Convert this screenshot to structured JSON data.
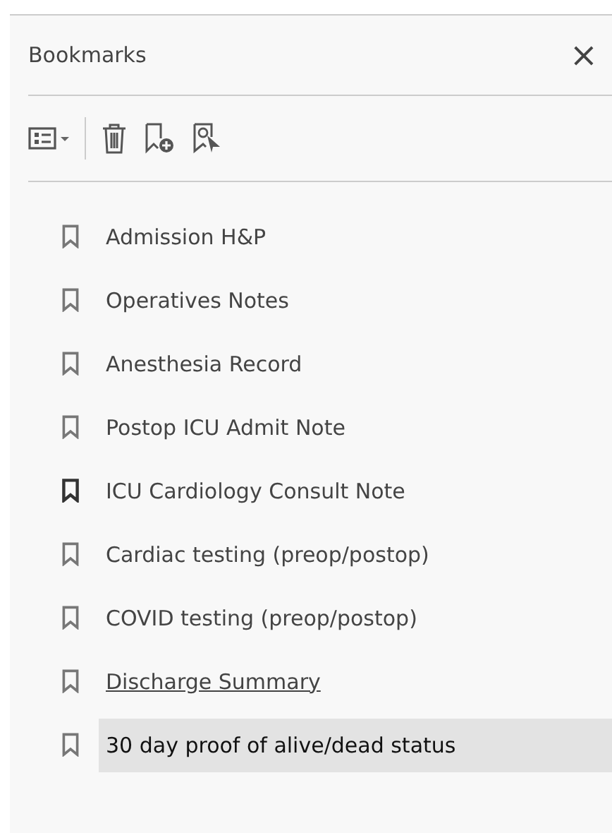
{
  "panel": {
    "title": "Bookmarks",
    "close": "×"
  },
  "bookmarks": [
    {
      "label": "Admission H&P",
      "selected": false,
      "hovered": false,
      "emphasized": false
    },
    {
      "label": "Operatives Notes",
      "selected": false,
      "hovered": false,
      "emphasized": false
    },
    {
      "label": "Anesthesia Record",
      "selected": false,
      "hovered": false,
      "emphasized": false
    },
    {
      "label": "Postop ICU Admit Note",
      "selected": false,
      "hovered": false,
      "emphasized": false
    },
    {
      "label": "ICU Cardiology Consult Note",
      "selected": false,
      "hovered": false,
      "emphasized": true
    },
    {
      "label": "Cardiac testing (preop/postop)",
      "selected": false,
      "hovered": false,
      "emphasized": false
    },
    {
      "label": "COVID testing (preop/postop)",
      "selected": false,
      "hovered": false,
      "emphasized": false
    },
    {
      "label": "Discharge Summary",
      "selected": false,
      "hovered": true,
      "emphasized": false
    },
    {
      "label": "30 day proof of alive/dead status",
      "selected": true,
      "hovered": false,
      "emphasized": false
    }
  ]
}
